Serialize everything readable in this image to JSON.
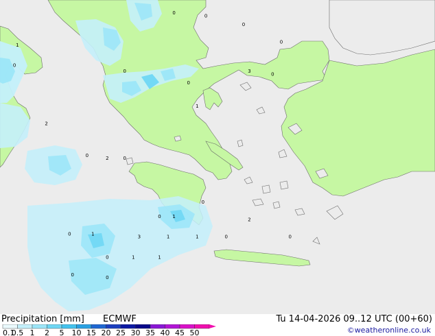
{
  "footer": {
    "title": "Precipitation [mm]",
    "model": "ECMWF",
    "valid": "Tu 14-04-2026 09..12 UTC (00+60)",
    "credit": "©weatheronline.co.uk"
  },
  "legend": {
    "ticks": [
      "0.1",
      "0.5",
      "1",
      "2",
      "5",
      "10",
      "15",
      "20",
      "25",
      "30",
      "35",
      "40",
      "45",
      "50"
    ],
    "colors": [
      "#eaf9fc",
      "#c4f0fb",
      "#9ce6f8",
      "#6fd7f4",
      "#44c3ee",
      "#2aa1e3",
      "#1e67d2",
      "#1b3fbf",
      "#0c19a3",
      "#07078a",
      "#8a17d5",
      "#b214d6",
      "#d912c8",
      "#f00fae"
    ]
  },
  "map": {
    "land_color": "#c6f7a3",
    "sea_color": "#ececec",
    "point_values": [
      {
        "label": "0",
        "lon": 21.0,
        "lat": 42.8
      },
      {
        "label": "0",
        "lon": 22.1,
        "lat": 42.7
      },
      {
        "label": "0",
        "lon": 23.4,
        "lat": 42.4
      },
      {
        "label": "1",
        "lon": 15.6,
        "lat": 41.7
      },
      {
        "label": "0",
        "lon": 15.5,
        "lat": 41.0
      },
      {
        "label": "0",
        "lon": 19.3,
        "lat": 40.8
      },
      {
        "label": "0",
        "lon": 21.5,
        "lat": 40.4
      },
      {
        "label": "1",
        "lon": 21.8,
        "lat": 39.6
      },
      {
        "label": "3",
        "lon": 23.6,
        "lat": 40.8
      },
      {
        "label": "0",
        "lon": 24.4,
        "lat": 40.7
      },
      {
        "label": "0",
        "lon": 24.7,
        "lat": 41.8
      },
      {
        "label": "2",
        "lon": 16.6,
        "lat": 39.0
      },
      {
        "label": "0",
        "lon": 18.0,
        "lat": 37.9
      },
      {
        "label": "2",
        "lon": 18.7,
        "lat": 37.8
      },
      {
        "label": "0",
        "lon": 19.3,
        "lat": 37.8
      },
      {
        "label": "0",
        "lon": 22.0,
        "lat": 36.3
      },
      {
        "label": "0",
        "lon": 20.5,
        "lat": 35.8
      },
      {
        "label": "1",
        "lon": 21.0,
        "lat": 35.8
      },
      {
        "label": "2",
        "lon": 23.6,
        "lat": 35.7
      },
      {
        "label": "0",
        "lon": 17.4,
        "lat": 35.2
      },
      {
        "label": "1",
        "lon": 18.2,
        "lat": 35.2
      },
      {
        "label": "3",
        "lon": 19.8,
        "lat": 35.1
      },
      {
        "label": "1",
        "lon": 20.8,
        "lat": 35.1
      },
      {
        "label": "1",
        "lon": 21.8,
        "lat": 35.1
      },
      {
        "label": "0",
        "lon": 22.8,
        "lat": 35.1
      },
      {
        "label": "0",
        "lon": 25.0,
        "lat": 35.1
      },
      {
        "label": "0",
        "lon": 18.7,
        "lat": 34.4
      },
      {
        "label": "1",
        "lon": 19.6,
        "lat": 34.4
      },
      {
        "label": "1",
        "lon": 20.5,
        "lat": 34.4
      },
      {
        "label": "0",
        "lon": 17.5,
        "lat": 33.8
      },
      {
        "label": "0",
        "lon": 18.7,
        "lat": 33.7
      }
    ]
  }
}
